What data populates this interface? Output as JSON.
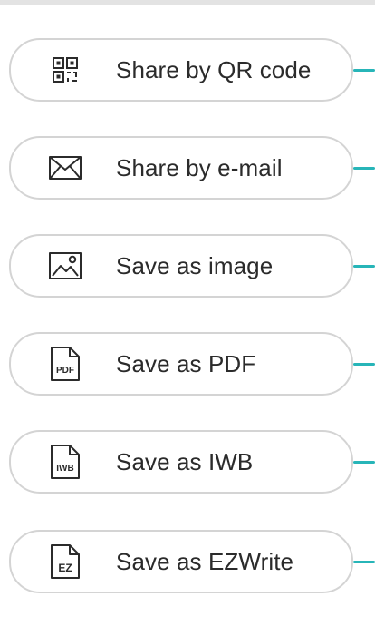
{
  "colors": {
    "accent": "#27b5b8",
    "border": "#d4d4d4",
    "text": "#2b2b2b"
  },
  "menu": {
    "items": [
      {
        "label": "Share by QR code",
        "icon": "qr-code-icon"
      },
      {
        "label": "Share by e-mail",
        "icon": "envelope-icon"
      },
      {
        "label": "Save as image",
        "icon": "image-icon"
      },
      {
        "label": "Save as PDF",
        "icon": "pdf-file-icon",
        "icon_text": "PDF"
      },
      {
        "label": "Save as IWB",
        "icon": "iwb-file-icon",
        "icon_text": "IWB"
      },
      {
        "label": "Save as EZWrite",
        "icon": "ezwrite-file-icon",
        "icon_text": "EZ"
      }
    ]
  }
}
